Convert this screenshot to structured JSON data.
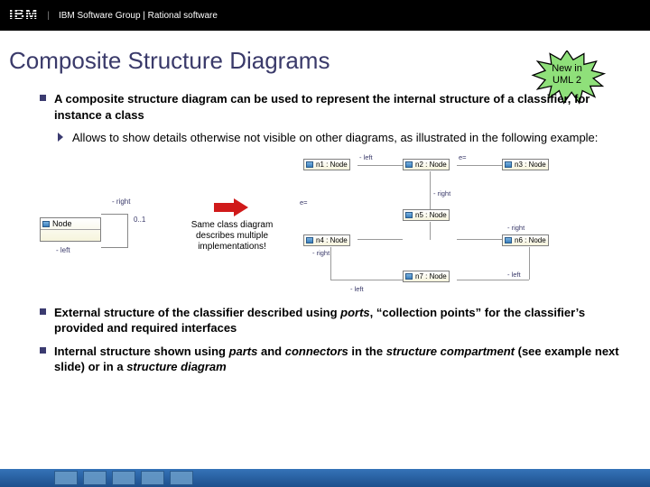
{
  "header": {
    "logo_text": "IBM",
    "breadcrumb": "IBM Software Group | Rational software"
  },
  "title": "Composite Structure Diagrams",
  "badge": {
    "line1": "New in",
    "line2": "UML 2"
  },
  "bullets": {
    "b1": "A composite structure diagram can be used to represent the internal structure of a classifier, for instance a class",
    "b2": "Allows to show details otherwise not visible on other diagrams, as illustrated in the following example:",
    "b3_pre": "External structure of the classifier described using ",
    "b3_em1": "ports",
    "b3_mid": ", “collection points” for the classifier’s provided and required interfaces",
    "b4_pre": "Internal structure shown using ",
    "b4_em1": "parts",
    "b4_mid1": " and ",
    "b4_em2": "connectors",
    "b4_mid2": " in the ",
    "b4_em3": "structure compartment",
    "b4_mid3": " (see example next slide) or in a ",
    "b4_em4": "structure diagram"
  },
  "left_diagram": {
    "class_name": "Node",
    "role_right": "- right",
    "mult": "0..1",
    "role_left": "- left"
  },
  "arrow_caption": "Same class diagram describes multiple implementations!",
  "right_diagram": {
    "n1": "n1 : Node",
    "n2": "n2 : Node",
    "n3": "n3 : Node",
    "n4": "n4 : Node",
    "n5": "n5 : Node",
    "n6": "n6 : Node",
    "n7": "n7 : Node",
    "lab_left": "- left",
    "lab_right": "- right",
    "lab_e": "e="
  }
}
